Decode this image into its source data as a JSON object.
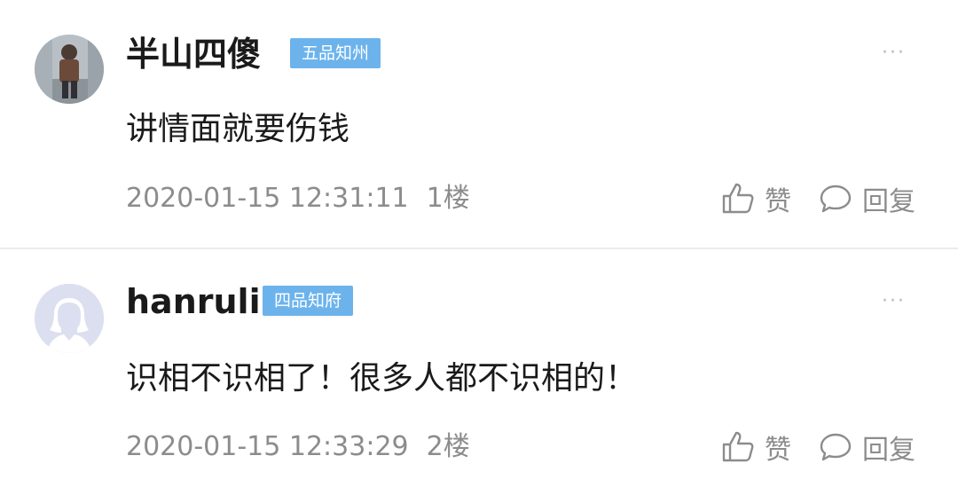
{
  "comments": [
    {
      "username": "半山四傻",
      "rank": "五品知州",
      "text": "讲情面就要伤钱",
      "timestamp": "2020-01-15 12:31:11",
      "floor": "1楼",
      "like_label": "赞",
      "reply_label": "回复",
      "more_icon": "more-dots-icon",
      "avatar": "photo-avatar"
    },
    {
      "username": "hanruli",
      "rank": "四品知府",
      "text": "识相不识相了！很多人都不识相的！",
      "timestamp": "2020-01-15 12:33:29",
      "floor": "2楼",
      "like_label": "赞",
      "reply_label": "回复",
      "more_icon": "more-dots-icon",
      "avatar": "default-avatar"
    }
  ],
  "colors": {
    "badge": "#6cb3ec",
    "text_primary": "#1a1a1a",
    "text_secondary": "#8c8c8c",
    "divider": "#ececec"
  }
}
